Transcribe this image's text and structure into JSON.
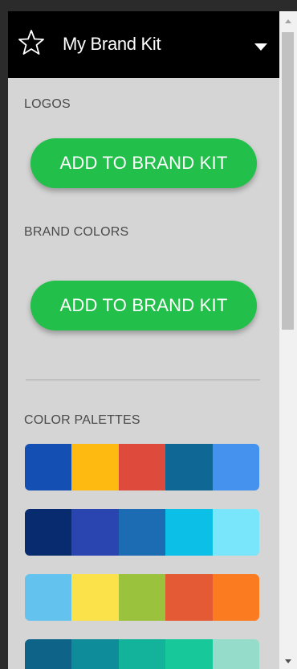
{
  "header": {
    "title": "My Brand Kit",
    "icon": "star-icon",
    "dropdown_icon": "chevron-down-icon"
  },
  "sections": {
    "logos_label": "LOGOS",
    "brand_colors_label": "BRAND COLORS",
    "color_palettes_label": "COLOR PALETTES"
  },
  "buttons": {
    "logos_add_label": "ADD TO BRAND KIT",
    "colors_add_label": "ADD TO BRAND KIT"
  },
  "theme": {
    "header_bg": "#000000",
    "panel_bg": "#d5d5d5",
    "accent_green": "#22c04a"
  },
  "palettes": [
    [
      "#1450b4",
      "#ffba12",
      "#de4a3c",
      "#0f6796",
      "#4591ee"
    ],
    [
      "#082a6e",
      "#2a44b0",
      "#1c6cb4",
      "#0cbfe6",
      "#7ae6fc"
    ],
    [
      "#64c2ee",
      "#fce24a",
      "#9ac23c",
      "#e45a34",
      "#fb7c20"
    ],
    [
      "#0e6488",
      "#0e8c9a",
      "#13b29a",
      "#16c89a",
      "#96dccb"
    ]
  ]
}
